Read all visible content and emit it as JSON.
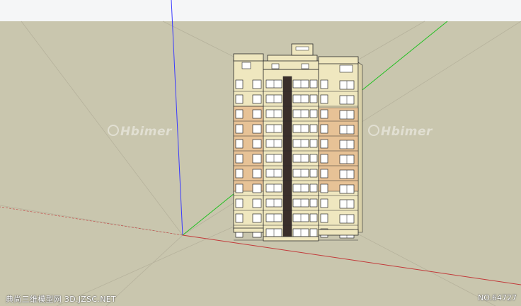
{
  "colors": {
    "sky": "#f5f6f7",
    "ground": "#c9c6ae",
    "facade_light": "#efe7bf",
    "facade_accent": "#e7c296",
    "outline": "#2a2a2a",
    "axis_blue": "#3a3aff",
    "axis_green": "#22c022",
    "axis_red": "#c23a3a",
    "inference_line": "#b8b4a0",
    "window_dark": "#3a2e2a",
    "window_glass": "#ffffff"
  },
  "watermarks": [
    {
      "text": "Hbimer",
      "icon": "logo-icon"
    },
    {
      "text": "Hbimer",
      "icon": "logo-icon"
    }
  ],
  "footer": {
    "left_text": "典尚三维模型网 3D.JZSC.NET",
    "right_text": "NO.64727"
  },
  "scene": {
    "building_floors": 11
  }
}
